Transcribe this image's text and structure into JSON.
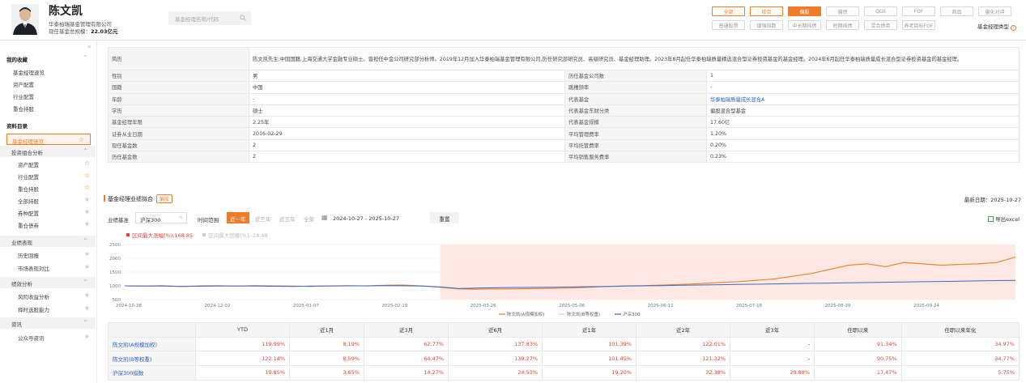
{
  "header": {
    "name": "陈文凯",
    "company": "华泰柏瑞基金管理有限公司",
    "scale_label": "现任基金总规模：",
    "scale_value": "22.03亿元",
    "search_placeholder": "基金经理名称/代码",
    "tabs_row1": [
      "全部",
      "综合",
      "偏股",
      "偏债",
      "QDII",
      "FOF",
      "商品",
      "量化对冲"
    ],
    "tabs_row2": [
      "普通股票",
      "增强指数",
      "中长期纯债",
      "短期纯债",
      "混合债券",
      "养老目标FOF"
    ],
    "active_tab": "偏股",
    "manager_type_link": "基金经理类型"
  },
  "sidebar": {
    "my_favorites": "我的收藏",
    "fav_items": [
      "基金经理速览",
      "资产配置",
      "行业配置",
      "重仓持股"
    ],
    "catalog": "资料目录",
    "selected": "基金经理速览",
    "group1": "投资组合分析",
    "group1_items": [
      "资产配置",
      "行业配置",
      "重仓持股",
      "全部持股",
      "券种配置",
      "重仓债券"
    ],
    "group2": "业绩表现",
    "group2_items": [
      "历史回报",
      "市场表现对比"
    ],
    "group3": "绩效分析",
    "group3_items": [
      "风险收益分析",
      "择时选股能力"
    ],
    "group4": "资讯",
    "group4_items": [
      "公众号资讯"
    ]
  },
  "profile": {
    "resume_label": "简历",
    "resume_text": "陈文凯先生:中国国籍,上海交通大学金融专业硕士。曾担任中金公司研究部分析师。2019年12月加入华泰柏瑞基金管理有限公司,历任研究部研究员、高级研究员、基金经理助理。2023年8月起任华泰柏瑞质量精选混合型证券投资基金的基金经理。2024年6月起任华泰柏瑞质量成长混合型证券投资基金的基金经理。",
    "rows": [
      [
        "性别",
        "男",
        "历任基金公司数",
        "1"
      ],
      [
        "国籍",
        "中国",
        "跳槽频率",
        "-"
      ],
      [
        "年龄",
        "-",
        "代表基金",
        "华泰柏瑞质量成长混合A"
      ],
      [
        "学历",
        "硕士",
        "代表基金东财分类",
        "偏股混合型基金"
      ],
      [
        "基金经理年限",
        "2.25年",
        "代表基金规模",
        "17.60亿"
      ],
      [
        "证券从业日期",
        "2016-02-29",
        "平均管理费率",
        "1.20%"
      ],
      [
        "现任基金数",
        "2",
        "平均托管费率",
        "0.20%"
      ],
      [
        "历任基金数",
        "2",
        "平均销售服务费率",
        "0.23%"
      ]
    ]
  },
  "perf_section": {
    "title": "基金经理业绩拟合",
    "tag": "偏股",
    "update_label": "最新日期：2025-10-27",
    "bench_label": "业绩基准",
    "bench_value": "沪深300",
    "range_label": "时间范围",
    "ranges": [
      "近一年",
      "近三年",
      "近五年",
      "全部"
    ],
    "active_range": "近一年",
    "date_range": "2024-10-27  -  2025-10-27",
    "confirm": "重置",
    "export": "导出excel",
    "max_drawdown": "区间最大涨幅(%):168.85",
    "max_drawdown2": "区间最大回撤(%):-28.48"
  },
  "chart_data": {
    "type": "line",
    "x_ticks": [
      "2024-10-28",
      "2024-12-02",
      "2025-01-07",
      "2025-02-19",
      "2025-03-26",
      "2025-05-06",
      "2025-06-11",
      "2025-07-16",
      "2025-08-20",
      "2025-09-24"
    ],
    "y_ticks": [
      500,
      1000,
      1500,
      2000,
      2500
    ],
    "ylim": [
      500,
      2500
    ],
    "series": [
      {
        "name": "陈文凯(A规模加权)",
        "color": "#f07c27",
        "values": [
          1000,
          990,
          1010,
          980,
          1000,
          1005,
          995,
          1010,
          1000,
          990,
          980,
          1000,
          1010,
          1000,
          1020,
          1030,
          1000,
          950,
          890,
          880,
          885,
          890,
          900,
          910,
          920,
          950,
          980,
          1000,
          1010,
          1030,
          1050,
          1080,
          1120,
          1150,
          1200,
          1250,
          1350,
          1450,
          1600,
          1750,
          1800,
          1700,
          1850,
          1800,
          1750,
          1780,
          1800,
          1850,
          2050
        ]
      },
      {
        "name": "陈文凯(B等权重)",
        "color": "#f7c9a8",
        "values": [
          1000,
          985,
          1005,
          975,
          995,
          1000,
          990,
          1005,
          995,
          985,
          975,
          995,
          1005,
          995,
          1015,
          1025,
          995,
          945,
          885,
          875,
          880,
          885,
          895,
          905,
          915,
          945,
          975,
          995,
          1005,
          1025,
          1045,
          1075,
          1115,
          1145,
          1195,
          1245,
          1345,
          1445,
          1590,
          1740,
          1790,
          1690,
          1840,
          1790,
          1740,
          1770,
          1790,
          1840,
          2040
        ]
      },
      {
        "name": "沪深300",
        "color": "#3a6bc4",
        "values": [
          1000,
          990,
          995,
          980,
          985,
          990,
          995,
          990,
          985,
          980,
          990,
          995,
          1000,
          1000,
          1010,
          1000,
          990,
          960,
          900,
          920,
          930,
          940,
          945,
          950,
          960,
          970,
          980,
          990,
          1000,
          1010,
          1020,
          1030,
          1040,
          1050,
          1060,
          1070,
          1080,
          1090,
          1100,
          1110,
          1120,
          1130,
          1140,
          1150,
          1160,
          1170,
          1180,
          1190,
          1200
        ]
      }
    ],
    "highlight_start_index": 17,
    "legend_position": "bottom"
  },
  "perf_table": {
    "headers": [
      "",
      "YTD",
      "近1月",
      "近3月",
      "近6月",
      "近1年",
      "近2年",
      "近3年",
      "任职以来",
      "任职以来年化"
    ],
    "rows": [
      [
        "陈文凯(A规模加权)",
        "119.99%",
        "8.19%",
        "62.77%",
        "137.83%",
        "101.39%",
        "122.01%",
        "-",
        "91.34%",
        "34.97%"
      ],
      [
        "陈文凯(B等权重)",
        "122.14%",
        "8.59%",
        "64.47%",
        "139.27%",
        "101.45%",
        "121.32%",
        "-",
        "90.75%",
        "34.77%"
      ],
      [
        "沪深300指数",
        "19.85%",
        "3.65%",
        "14.27%",
        "24.53%",
        "19.20%",
        "32.38%",
        "29.88%",
        "17.47%",
        "5.75%"
      ]
    ]
  }
}
